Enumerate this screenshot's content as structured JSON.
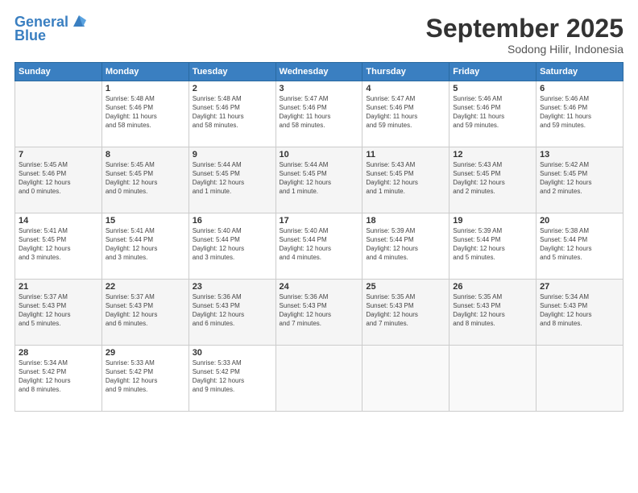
{
  "header": {
    "logo_line1": "General",
    "logo_line2": "Blue",
    "month": "September 2025",
    "location": "Sodong Hilir, Indonesia"
  },
  "weekdays": [
    "Sunday",
    "Monday",
    "Tuesday",
    "Wednesday",
    "Thursday",
    "Friday",
    "Saturday"
  ],
  "weeks": [
    [
      {
        "day": "",
        "info": ""
      },
      {
        "day": "1",
        "info": "Sunrise: 5:48 AM\nSunset: 5:46 PM\nDaylight: 11 hours\nand 58 minutes."
      },
      {
        "day": "2",
        "info": "Sunrise: 5:48 AM\nSunset: 5:46 PM\nDaylight: 11 hours\nand 58 minutes."
      },
      {
        "day": "3",
        "info": "Sunrise: 5:47 AM\nSunset: 5:46 PM\nDaylight: 11 hours\nand 58 minutes."
      },
      {
        "day": "4",
        "info": "Sunrise: 5:47 AM\nSunset: 5:46 PM\nDaylight: 11 hours\nand 59 minutes."
      },
      {
        "day": "5",
        "info": "Sunrise: 5:46 AM\nSunset: 5:46 PM\nDaylight: 11 hours\nand 59 minutes."
      },
      {
        "day": "6",
        "info": "Sunrise: 5:46 AM\nSunset: 5:46 PM\nDaylight: 11 hours\nand 59 minutes."
      }
    ],
    [
      {
        "day": "7",
        "info": "Sunrise: 5:45 AM\nSunset: 5:46 PM\nDaylight: 12 hours\nand 0 minutes."
      },
      {
        "day": "8",
        "info": "Sunrise: 5:45 AM\nSunset: 5:45 PM\nDaylight: 12 hours\nand 0 minutes."
      },
      {
        "day": "9",
        "info": "Sunrise: 5:44 AM\nSunset: 5:45 PM\nDaylight: 12 hours\nand 1 minute."
      },
      {
        "day": "10",
        "info": "Sunrise: 5:44 AM\nSunset: 5:45 PM\nDaylight: 12 hours\nand 1 minute."
      },
      {
        "day": "11",
        "info": "Sunrise: 5:43 AM\nSunset: 5:45 PM\nDaylight: 12 hours\nand 1 minute."
      },
      {
        "day": "12",
        "info": "Sunrise: 5:43 AM\nSunset: 5:45 PM\nDaylight: 12 hours\nand 2 minutes."
      },
      {
        "day": "13",
        "info": "Sunrise: 5:42 AM\nSunset: 5:45 PM\nDaylight: 12 hours\nand 2 minutes."
      }
    ],
    [
      {
        "day": "14",
        "info": "Sunrise: 5:41 AM\nSunset: 5:45 PM\nDaylight: 12 hours\nand 3 minutes."
      },
      {
        "day": "15",
        "info": "Sunrise: 5:41 AM\nSunset: 5:44 PM\nDaylight: 12 hours\nand 3 minutes."
      },
      {
        "day": "16",
        "info": "Sunrise: 5:40 AM\nSunset: 5:44 PM\nDaylight: 12 hours\nand 3 minutes."
      },
      {
        "day": "17",
        "info": "Sunrise: 5:40 AM\nSunset: 5:44 PM\nDaylight: 12 hours\nand 4 minutes."
      },
      {
        "day": "18",
        "info": "Sunrise: 5:39 AM\nSunset: 5:44 PM\nDaylight: 12 hours\nand 4 minutes."
      },
      {
        "day": "19",
        "info": "Sunrise: 5:39 AM\nSunset: 5:44 PM\nDaylight: 12 hours\nand 5 minutes."
      },
      {
        "day": "20",
        "info": "Sunrise: 5:38 AM\nSunset: 5:44 PM\nDaylight: 12 hours\nand 5 minutes."
      }
    ],
    [
      {
        "day": "21",
        "info": "Sunrise: 5:37 AM\nSunset: 5:43 PM\nDaylight: 12 hours\nand 5 minutes."
      },
      {
        "day": "22",
        "info": "Sunrise: 5:37 AM\nSunset: 5:43 PM\nDaylight: 12 hours\nand 6 minutes."
      },
      {
        "day": "23",
        "info": "Sunrise: 5:36 AM\nSunset: 5:43 PM\nDaylight: 12 hours\nand 6 minutes."
      },
      {
        "day": "24",
        "info": "Sunrise: 5:36 AM\nSunset: 5:43 PM\nDaylight: 12 hours\nand 7 minutes."
      },
      {
        "day": "25",
        "info": "Sunrise: 5:35 AM\nSunset: 5:43 PM\nDaylight: 12 hours\nand 7 minutes."
      },
      {
        "day": "26",
        "info": "Sunrise: 5:35 AM\nSunset: 5:43 PM\nDaylight: 12 hours\nand 8 minutes."
      },
      {
        "day": "27",
        "info": "Sunrise: 5:34 AM\nSunset: 5:43 PM\nDaylight: 12 hours\nand 8 minutes."
      }
    ],
    [
      {
        "day": "28",
        "info": "Sunrise: 5:34 AM\nSunset: 5:42 PM\nDaylight: 12 hours\nand 8 minutes."
      },
      {
        "day": "29",
        "info": "Sunrise: 5:33 AM\nSunset: 5:42 PM\nDaylight: 12 hours\nand 9 minutes."
      },
      {
        "day": "30",
        "info": "Sunrise: 5:33 AM\nSunset: 5:42 PM\nDaylight: 12 hours\nand 9 minutes."
      },
      {
        "day": "",
        "info": ""
      },
      {
        "day": "",
        "info": ""
      },
      {
        "day": "",
        "info": ""
      },
      {
        "day": "",
        "info": ""
      }
    ]
  ]
}
